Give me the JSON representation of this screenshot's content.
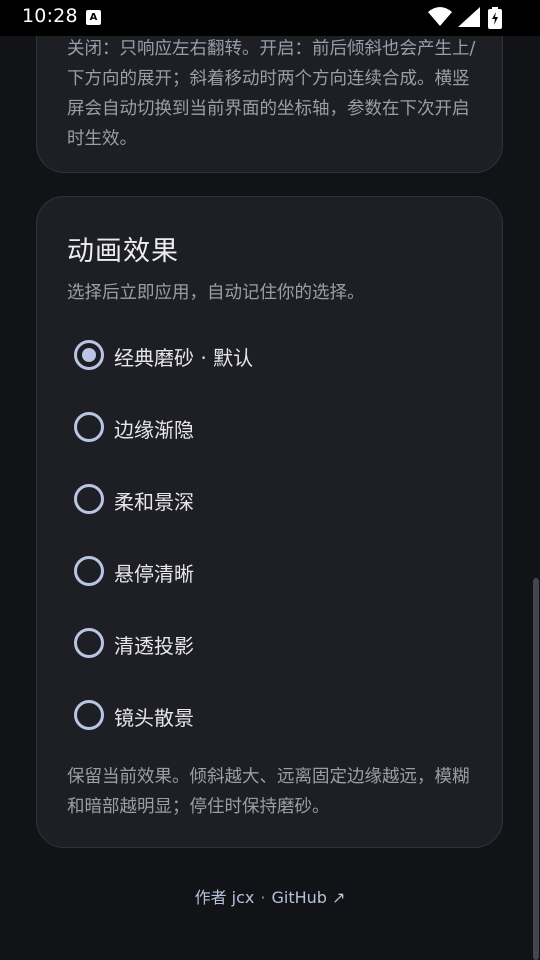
{
  "status_bar": {
    "time": "10:28",
    "notification_icon": "A"
  },
  "top_card": {
    "description": "关闭：只响应左右翻转。开启：前后倾斜也会产生上/下方向的展开；斜着移动时两个方向连续合成。横竖屏会自动切换到当前界面的坐标轴，参数在下次开启时生效。"
  },
  "animation_card": {
    "title": "动画效果",
    "subtitle": "选择后立即应用，自动记住你的选择。",
    "options": [
      {
        "label": "经典磨砂 · 默认",
        "selected": true
      },
      {
        "label": "边缘渐隐",
        "selected": false
      },
      {
        "label": "柔和景深",
        "selected": false
      },
      {
        "label": "悬停清晰",
        "selected": false
      },
      {
        "label": "清透投影",
        "selected": false
      },
      {
        "label": "镜头散景",
        "selected": false
      }
    ],
    "description": "保留当前效果。倾斜越大、远离固定边缘越远，模糊和暗部越明显；停住时保持磨砂。"
  },
  "footer": {
    "author": "作者 jcx",
    "separator": "·",
    "github_link": "GitHub ↗"
  },
  "colors": {
    "background": "#121317",
    "card": "#1d1f25",
    "accent": "#bac5e3",
    "muted_text": "#9b9ea6"
  }
}
